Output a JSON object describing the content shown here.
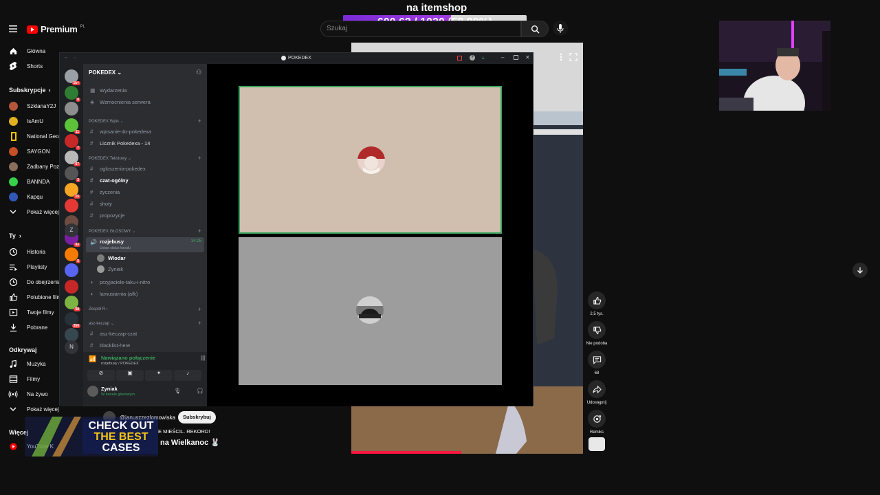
{
  "overlay": {
    "title": "na itemshop",
    "goal_text": "600.63 / 1020 (58.89%)",
    "goal_fraction": 0.5889
  },
  "youtube": {
    "logo_text": "Premium",
    "logo_region": "PL",
    "search_placeholder": "Szukaj",
    "nav": [
      {
        "label": "Główna",
        "icon": "home-icon"
      },
      {
        "label": "Shorts",
        "icon": "shorts-icon"
      }
    ],
    "subs_header": "Subskrypcje",
    "subscriptions": [
      {
        "label": "SzklanaY2J",
        "color": "#b5563a"
      },
      {
        "label": "IsAmU",
        "color": "#e0b020"
      },
      {
        "label": "National Geo",
        "color": "#f6c700"
      },
      {
        "label": "SAYGON",
        "color": "#c64f24"
      },
      {
        "label": "Zadbany Poz",
        "color": "#8a6d5b"
      },
      {
        "label": "BANNDA",
        "color": "#37d04b"
      },
      {
        "label": "Kapqu",
        "color": "#3157b8"
      }
    ],
    "show_more": "Pokaż więcej",
    "you_header": "Ty",
    "you_items": [
      {
        "label": "Historia",
        "icon": "history-icon"
      },
      {
        "label": "Playlisty",
        "icon": "playlist-icon"
      },
      {
        "label": "Do obejrzenia",
        "icon": "watch-later-icon"
      },
      {
        "label": "Polubione filmy",
        "icon": "like-icon"
      },
      {
        "label": "Twoje filmy",
        "icon": "your-videos-icon"
      },
      {
        "label": "Pobrane",
        "icon": "download-icon"
      }
    ],
    "explore_header": "Odkrywaj",
    "explore_items": [
      {
        "label": "Muzyka",
        "icon": "music-icon"
      },
      {
        "label": "Filmy",
        "icon": "film-icon"
      },
      {
        "label": "Na żywo",
        "icon": "live-icon"
      }
    ],
    "show_more_2": "Pokaż więcej",
    "more_header": "Więcej",
    "more_items": [
      {
        "label": "YouTube K",
        "icon": "youtube-kids-icon"
      }
    ]
  },
  "short": {
    "channel": "@januszzezlomowiska",
    "subscribe": "Subskrybuj",
    "line1": "E MIEŚCIL. REKORD!",
    "line2": "na Wielkanoc 🐰",
    "likes": "2,5 tys.",
    "dislike_label": "Nie podoba",
    "comments": "68",
    "share": "Udostępnij",
    "remix": "Remiks",
    "progress": 0.47
  },
  "discord": {
    "window_title": "POKEDEX",
    "server_name": "POKEDEX",
    "top_items": [
      {
        "label": "Wydarzenia",
        "icon": "calendar-icon"
      },
      {
        "label": "Wzmocnienia serwera",
        "icon": "boost-icon"
      }
    ],
    "categories": [
      {
        "name": "POKEDEX Wpis",
        "channels": [
          "wpisanie-do-pokedexa",
          "Licznik Pokedexa - 14"
        ]
      },
      {
        "name": "POKEDEX Tekstowy",
        "channels": [
          "ogloszenia-pokedex",
          "czat-ogólny",
          "życzenia",
          "shoty",
          "propozycje"
        ]
      },
      {
        "name": "POKEDEX GŁOSOWY",
        "channels": []
      },
      {
        "name": "Zespół R",
        "channels": []
      },
      {
        "name": "asz-keczap",
        "channels": [
          "asz-keczap-czat",
          "blacklist-here"
        ]
      }
    ],
    "voice_channel": {
      "name": "rozjebusy",
      "sub": "Ustaw status kanału",
      "time": "34:25"
    },
    "voice_members": [
      "Wlodar",
      "Zyniak"
    ],
    "other_voice": [
      "przyjaciele-taku-i-nitro",
      "lamusiarnia (afk)"
    ],
    "guild_badges": [
      "1k+",
      "8",
      "",
      "11",
      "7",
      "67",
      "3",
      "15",
      "",
      "",
      "43",
      "5",
      "",
      "",
      "58",
      "350",
      ""
    ],
    "guild_letters": [
      "Z",
      "N"
    ],
    "connection": {
      "status": "Nawiązano połączenie",
      "path": "rozjebusy / POKEDEX"
    },
    "user": {
      "name": "Zyniak",
      "status": "W kanale głosowym"
    }
  },
  "banner": {
    "line1": "CHECK OUT",
    "line2": "THE BEST",
    "line3": "CASES"
  }
}
